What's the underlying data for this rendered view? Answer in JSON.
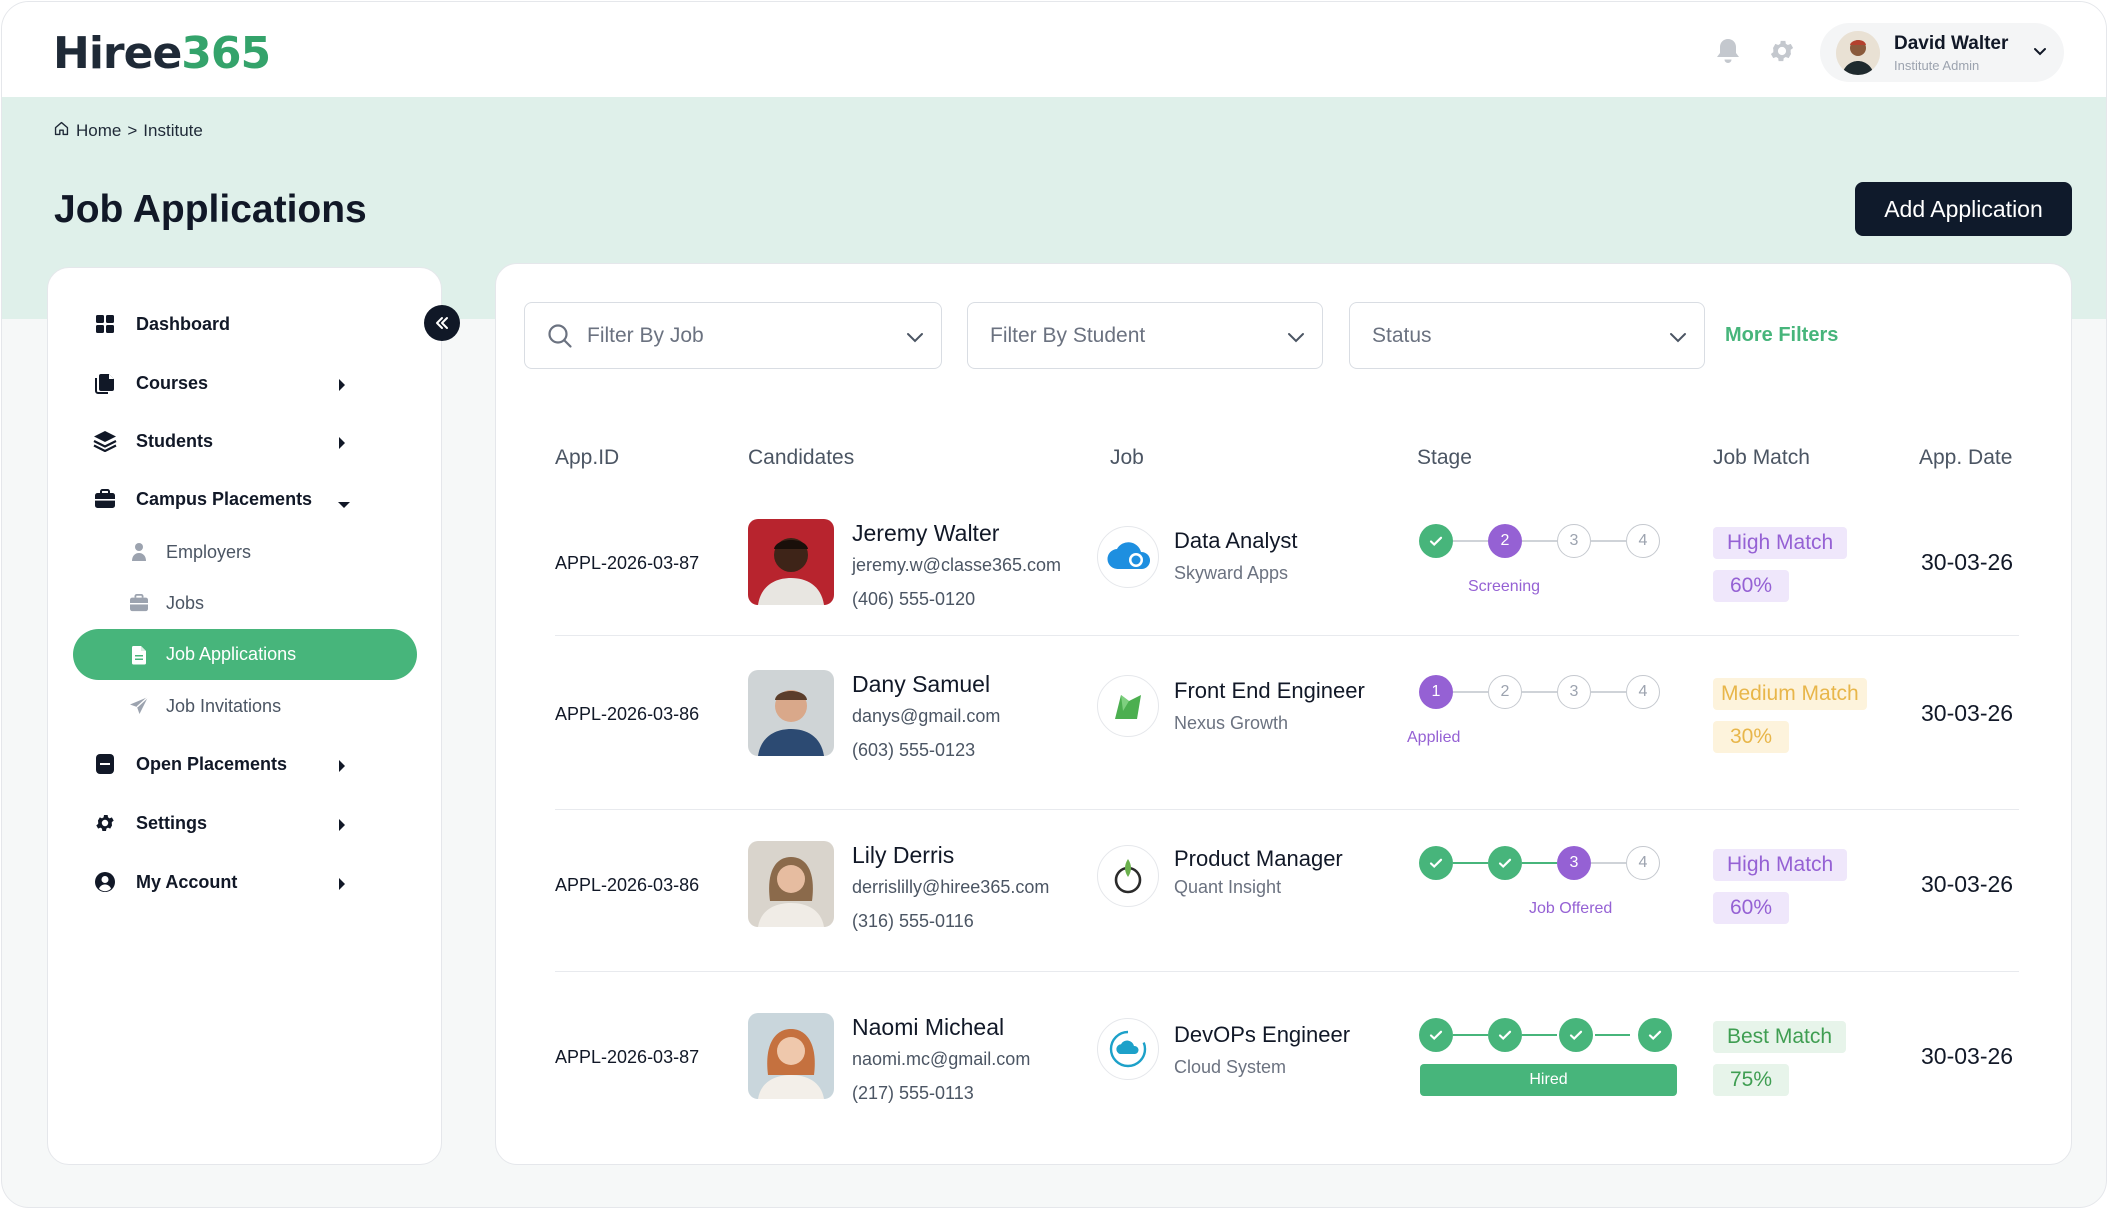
{
  "brand": {
    "logo_main": "Hiree",
    "logo_accent": "365"
  },
  "user": {
    "name": "David Walter",
    "role": "Institute Admin"
  },
  "breadcrumb": {
    "home": "Home",
    "separator": ">",
    "current": "Institute"
  },
  "page": {
    "title": "Job Applications",
    "add_button": "Add Application"
  },
  "sidebar": {
    "items": [
      {
        "label": "Dashboard",
        "icon": "grid-icon"
      },
      {
        "label": "Courses",
        "icon": "documents-icon"
      },
      {
        "label": "Students",
        "icon": "layers-icon"
      },
      {
        "label": "Campus Placements",
        "icon": "briefcase-icon"
      },
      {
        "label": "Open Placements",
        "icon": "card-icon"
      },
      {
        "label": "Settings",
        "icon": "gear-icon"
      },
      {
        "label": "My Account",
        "icon": "user-circle-icon"
      }
    ],
    "sub_items": [
      {
        "label": "Employers",
        "icon": "person-icon"
      },
      {
        "label": "Jobs",
        "icon": "briefcase-icon"
      },
      {
        "label": "Job Applications",
        "icon": "document-icon",
        "active": true
      },
      {
        "label": "Job Invitations",
        "icon": "send-icon"
      }
    ]
  },
  "filters": {
    "job_placeholder": "Filter By Job",
    "student_placeholder": "Filter By Student",
    "status_placeholder": "Status",
    "more": "More Filters"
  },
  "table": {
    "headers": [
      "App.ID",
      "Candidates",
      "Job",
      "Stage",
      "Job Match",
      "App. Date"
    ],
    "rows": [
      {
        "app_id": "APPL-2026-03-87",
        "name": "Jeremy Walter",
        "email": "jeremy.w@classe365.com",
        "phone": "(406) 555-0120",
        "job": "Data Analyst",
        "company": "Skyward Apps",
        "stage_label": "Screening",
        "steps": [
          "",
          "2",
          "3",
          "4"
        ],
        "match": "High Match",
        "percent": "60%",
        "date": "30-03-26"
      },
      {
        "app_id": "APPL-2026-03-86",
        "name": "Dany Samuel",
        "email": "danys@gmail.com",
        "phone": "(603) 555-0123",
        "job": "Front End Engineer",
        "company": "Nexus Growth",
        "stage_label": "Applied",
        "steps": [
          "1",
          "2",
          "3",
          "4"
        ],
        "match": "Medium Match",
        "percent": "30%",
        "date": "30-03-26"
      },
      {
        "app_id": "APPL-2026-03-86",
        "name": "Lily Derris",
        "email": "derrislilly@hiree365.com",
        "phone": "(316) 555-0116",
        "job": "Product Manager",
        "company": "Quant Insight",
        "stage_label": "Job Offered",
        "steps": [
          "",
          "",
          "3",
          "4"
        ],
        "match": "High Match",
        "percent": "60%",
        "date": "30-03-26"
      },
      {
        "app_id": "APPL-2026-03-87",
        "name": "Naomi Micheal",
        "email": "naomi.mc@gmail.com",
        "phone": "(217) 555-0113",
        "job": "DevOPs Engineer",
        "company": "Cloud System",
        "stage_label": "Hired",
        "steps": [
          "",
          "",
          "",
          ""
        ],
        "match": "Best Match",
        "percent": "75%",
        "date": "30-03-26"
      }
    ]
  },
  "colors": {
    "primary_green": "#47b57b",
    "dark_navy": "#0f1a2b",
    "mint_band": "#dff0ea",
    "purple": "#9561d4",
    "amber": "#e8b64a"
  }
}
